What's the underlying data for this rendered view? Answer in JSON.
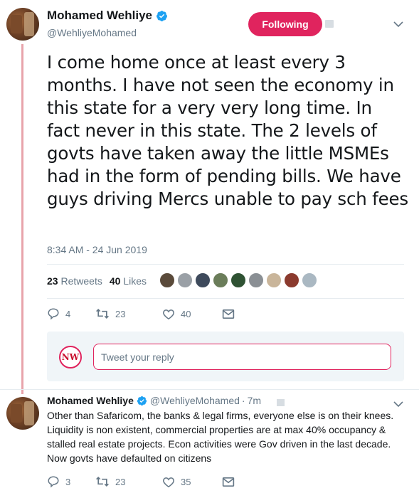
{
  "main_tweet": {
    "display_name": "Mohamed Wehliye",
    "handle": "@WehliyeMohamed",
    "follow_label": "Following",
    "text": "I come home once at least every 3 months. I have not seen the economy in this state for a very very long time. In fact never in this state. The 2 levels of govts have taken away the little MSMEs had in the form of pending bills. We have guys driving Mercs unable to pay sch fees",
    "timestamp": "8:34 AM - 24 Jun 2019",
    "retweets_count": "23",
    "retweets_label": "Retweets",
    "likes_count": "40",
    "likes_label": "Likes",
    "actions": {
      "reply_count": "4",
      "retweet_count": "23",
      "like_count": "40"
    }
  },
  "likers": [
    {
      "color": "#5a4a3a"
    },
    {
      "color": "#9aa0a6"
    },
    {
      "color": "#3e4a5c"
    },
    {
      "color": "#6b7d5a"
    },
    {
      "color": "#2f5233"
    },
    {
      "color": "#8a8f94"
    },
    {
      "color": "#c9b59a"
    },
    {
      "color": "#8b3a2e"
    },
    {
      "color": "#aab8c2"
    }
  ],
  "reply_box": {
    "placeholder": "Tweet your reply",
    "logo_text": "NW"
  },
  "reply_tweet": {
    "display_name": "Mohamed Wehliye",
    "handle": "@WehliyeMohamed",
    "separator": "·",
    "time": "7m",
    "text": "Other than Safaricom, the banks & legal firms, everyone else is on their knees. Liquidity is non existent, commercial properties are at max 40% occupancy & stalled real estate projects. Econ activities were Gov driven in the last decade. Now govts have defaulted on citizens",
    "actions": {
      "reply_count": "3",
      "retweet_count": "23",
      "like_count": "35"
    }
  },
  "colors": {
    "accent": "#e0245e",
    "verified": "#1da1f2",
    "muted": "#657786",
    "thread_line": "#e8a4ab"
  },
  "icons": [
    "verified-badge-icon",
    "chevron-down-icon",
    "reply-icon",
    "retweet-icon",
    "like-icon",
    "direct-message-icon",
    "card-icon"
  ]
}
